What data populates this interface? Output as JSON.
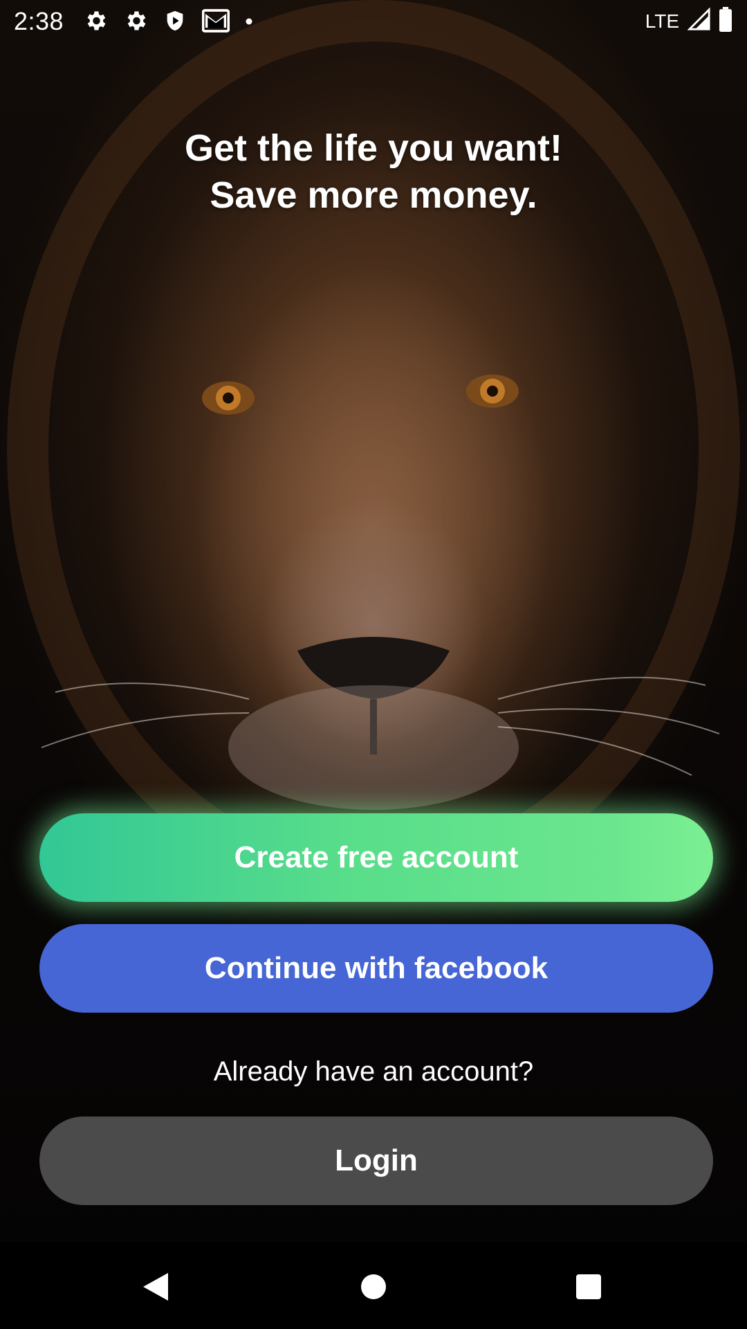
{
  "status_bar": {
    "time": "2:38",
    "network": "LTE",
    "left_icons": [
      "settings-icon",
      "settings-icon",
      "shield-icon",
      "gmail-icon",
      "notification-dot-icon"
    ],
    "right_icons": [
      "signal-icon",
      "battery-icon"
    ]
  },
  "hero": {
    "line1": "Get the life you want!",
    "line2": "Save more money."
  },
  "actions": {
    "create_label": "Create free account",
    "facebook_label": "Continue with facebook",
    "already_text": "Already have an account?",
    "login_label": "Login"
  },
  "nav": {
    "items": [
      "back-icon",
      "home-icon",
      "recents-icon"
    ]
  },
  "colors": {
    "create_gradient_start": "#32c796",
    "create_gradient_end": "#7cef92",
    "facebook": "#4666d6",
    "login": "#787878"
  }
}
